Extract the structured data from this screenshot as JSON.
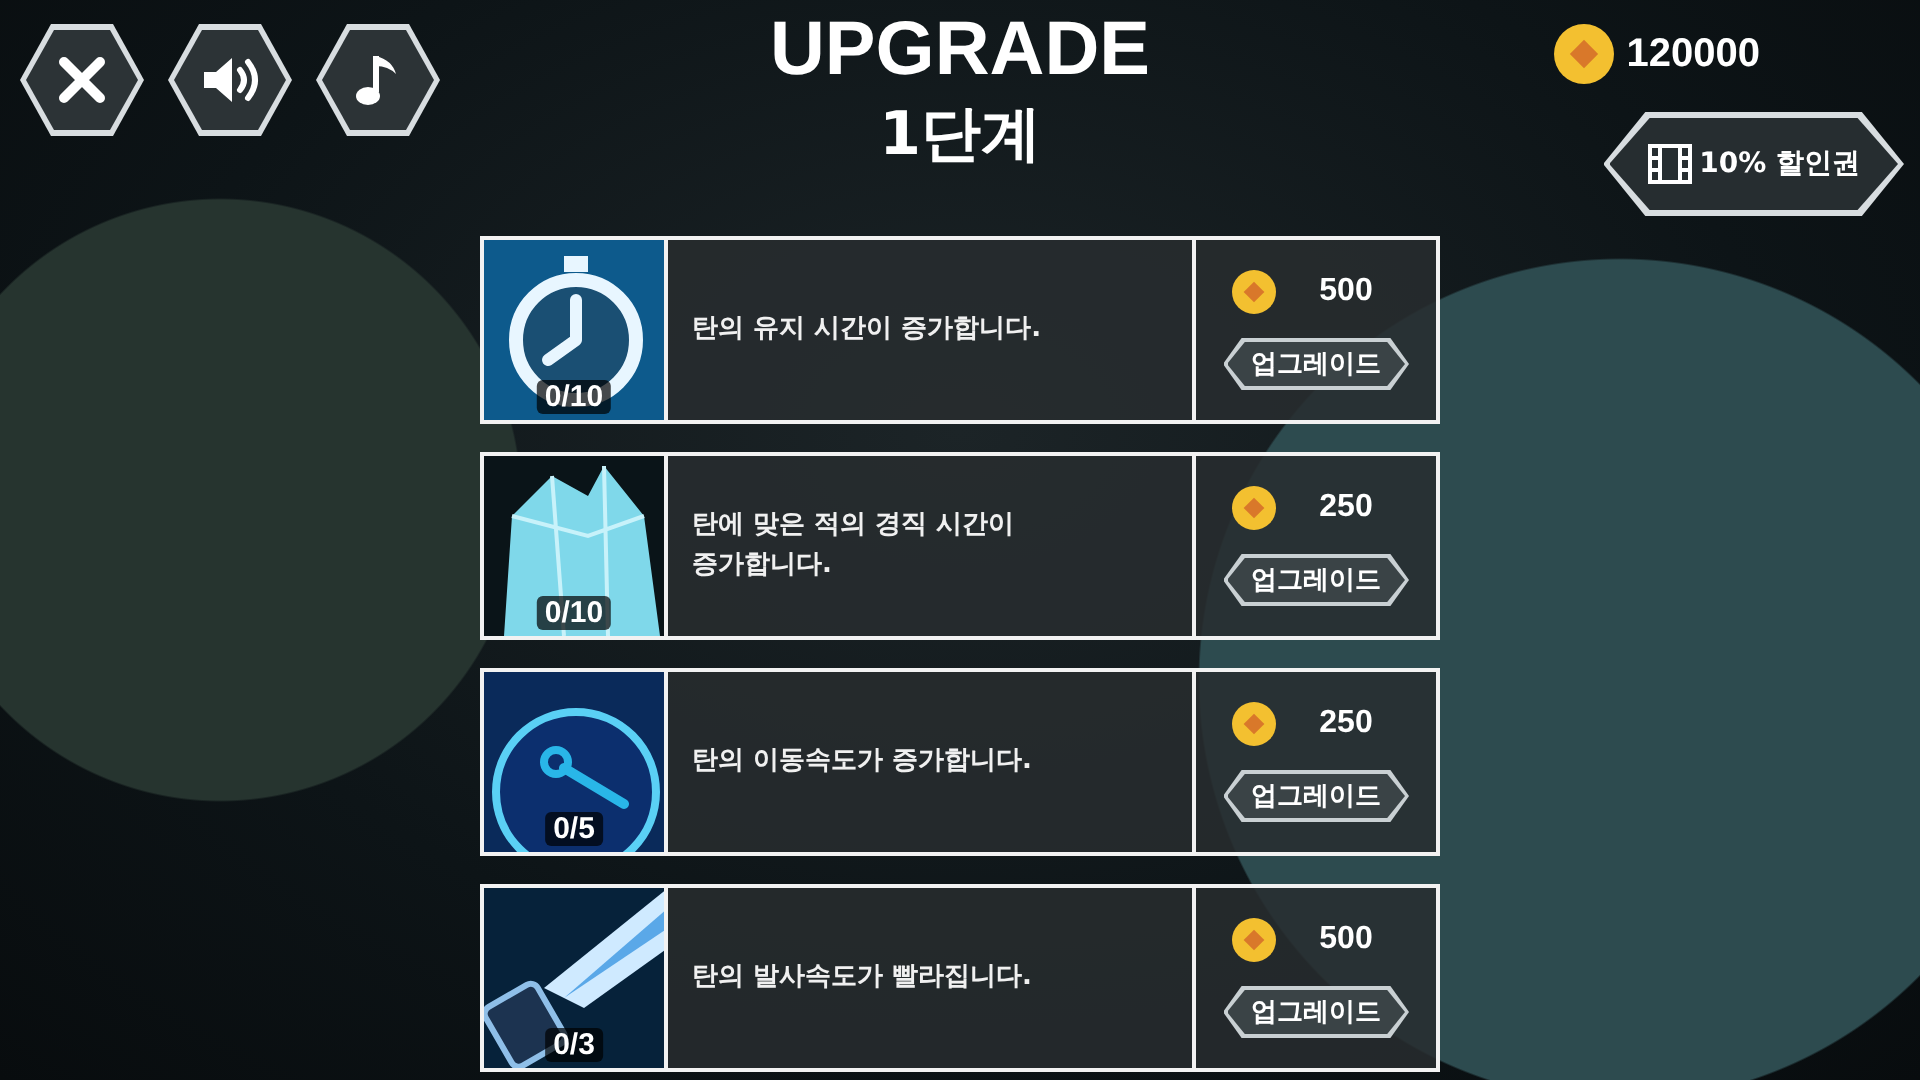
{
  "toolbar": [
    {
      "kind": "close"
    },
    {
      "kind": "sound"
    },
    {
      "kind": "music"
    }
  ],
  "title": "UPGRADE",
  "stage": "1단계",
  "coins": "120000",
  "coupon": {
    "label": "10% 할인권"
  },
  "upgrades": [
    {
      "kind": "stopwatch",
      "progress": "0/10",
      "description": "탄의 유지 시간이 증가합니다.",
      "price": "500",
      "button": "업그레이드"
    },
    {
      "kind": "crystal",
      "progress": "0/10",
      "description": "탄에 맞은 적의 경직 시간이\n증가합니다.",
      "price": "250",
      "button": "업그레이드"
    },
    {
      "kind": "gauge",
      "progress": "0/5",
      "description": "탄의 이동속도가 증가합니다.",
      "price": "250",
      "button": "업그레이드"
    },
    {
      "kind": "blast",
      "progress": "0/3",
      "description": "탄의 발사속도가 빨라집니다.",
      "price": "500",
      "button": "업그레이드"
    }
  ]
}
